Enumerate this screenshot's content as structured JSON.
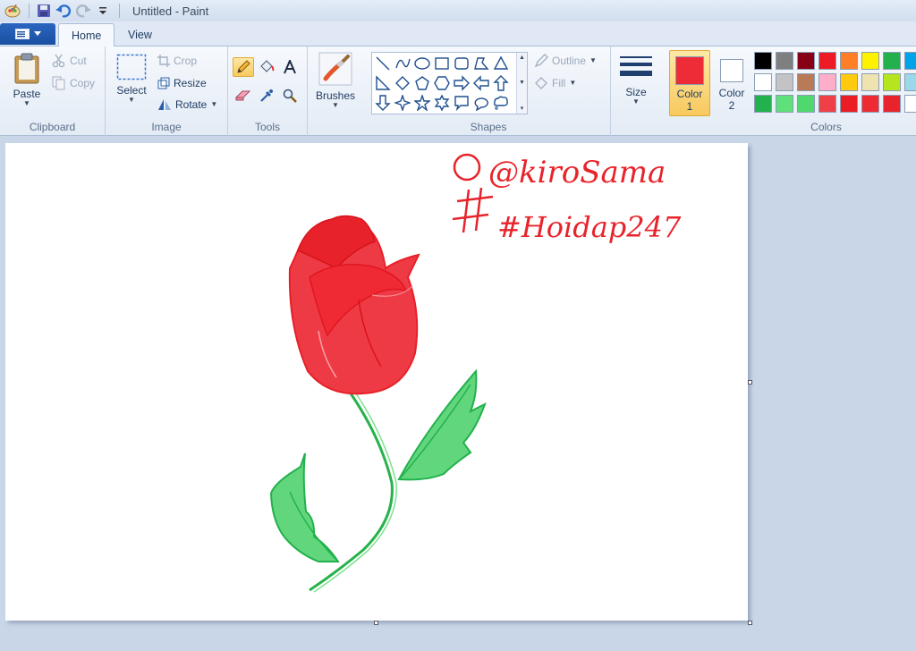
{
  "window": {
    "title": "Untitled - Paint"
  },
  "tabs": [
    {
      "label": "Home",
      "active": true
    },
    {
      "label": "View",
      "active": false
    }
  ],
  "clipboard": {
    "paste": "Paste",
    "cut": "Cut",
    "copy": "Copy",
    "group": "Clipboard"
  },
  "image": {
    "select": "Select",
    "crop": "Crop",
    "resize": "Resize",
    "rotate": "Rotate",
    "group": "Image"
  },
  "tools": {
    "group": "Tools",
    "active_tool": "pencil"
  },
  "brushes": {
    "label": "Brushes"
  },
  "shapes": {
    "group": "Shapes",
    "outline": "Outline",
    "fill": "Fill"
  },
  "size": {
    "label": "Size"
  },
  "colors": {
    "group": "Colors",
    "color1_label": "Color\n1",
    "color1_line1": "Color",
    "color1_line2": "1",
    "color2_line1": "Color",
    "color2_line2": "2",
    "color1_value": "#ed2c37",
    "color2_value": "#ffffff",
    "palette": [
      [
        "#000000",
        "#7f7f7f",
        "#880015",
        "#ed1c24",
        "#ff7f27",
        "#fff200",
        "#22b14c",
        "#00a2e8"
      ],
      [
        "#ffffff",
        "#c3c3c3",
        "#b97a57",
        "#ffaec9",
        "#ffc90e",
        "#efe4b0",
        "#b5e61d",
        "#99d9ea"
      ],
      [
        "#22b14c",
        "#5ee07a",
        "#4fd86e",
        "#ef4048",
        "#ec1c24",
        "#ee2a33",
        "#e8232b",
        "#ffffff"
      ]
    ]
  },
  "canvas": {
    "handwriting_line1": "@kiroSama",
    "handwriting_line2": "#Hoidap247"
  }
}
